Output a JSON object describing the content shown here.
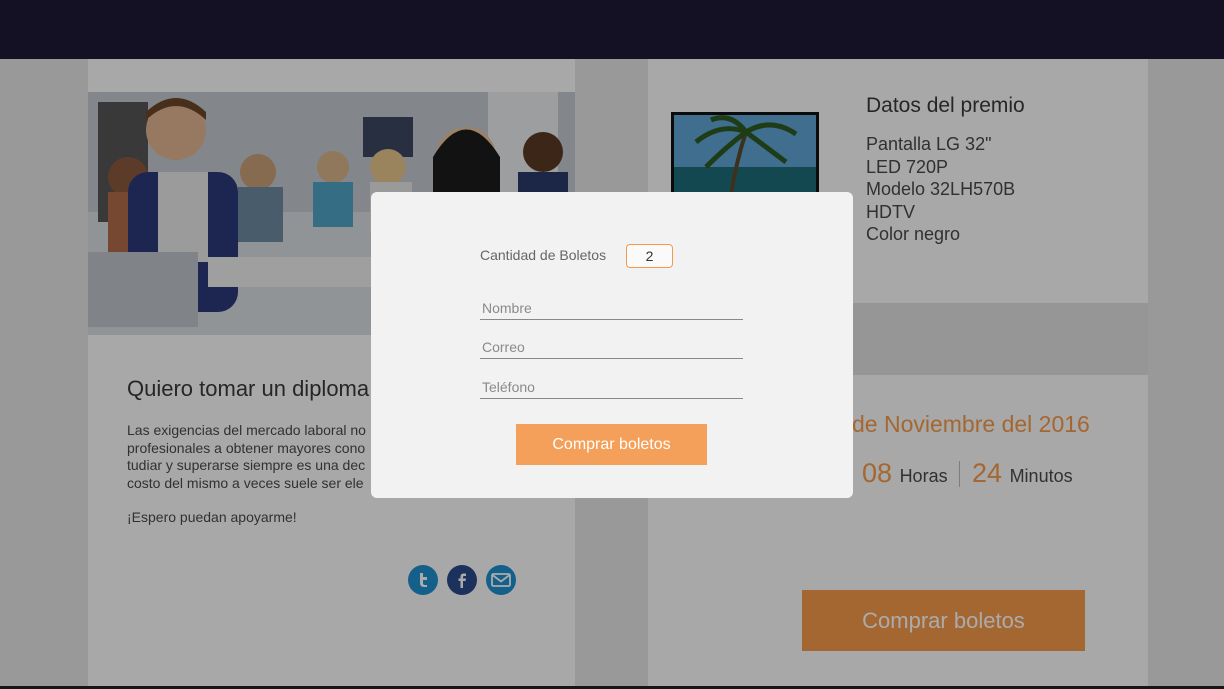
{
  "left": {
    "title": "Quiero tomar un diploma",
    "body_lines": [
      "Las exigencias del mercado laboral no",
      "profesionales a obtener mayores cono",
      "tudiar y superarse siempre es una dec",
      "costo del mismo a veces suele ser ele"
    ],
    "sign": "¡Espero puedan apoyarme!",
    "social": [
      "twitter-icon",
      "facebook-icon",
      "mail-icon"
    ]
  },
  "prize": {
    "title": "Datos del premio",
    "items": [
      "Pantalla LG 32\"",
      "LED 720P",
      "Modelo 32LH570B",
      "HDTV",
      "Color negro"
    ]
  },
  "countdown": {
    "date": "de Noviembre del 2016",
    "hours_value": "08",
    "hours_label": "Horas",
    "minutes_value": "24",
    "minutes_label": "Minutos"
  },
  "main_button_label": "Comprar boletos",
  "modal": {
    "qty_label": "Cantidad de Boletos",
    "qty_value": "2",
    "name_placeholder": "Nombre",
    "email_placeholder": "Correo",
    "phone_placeholder": "Teléfono",
    "button_label": "Comprar boletos"
  },
  "colors": {
    "accent": "#f59a4b",
    "topbar": "#1f1a36"
  }
}
